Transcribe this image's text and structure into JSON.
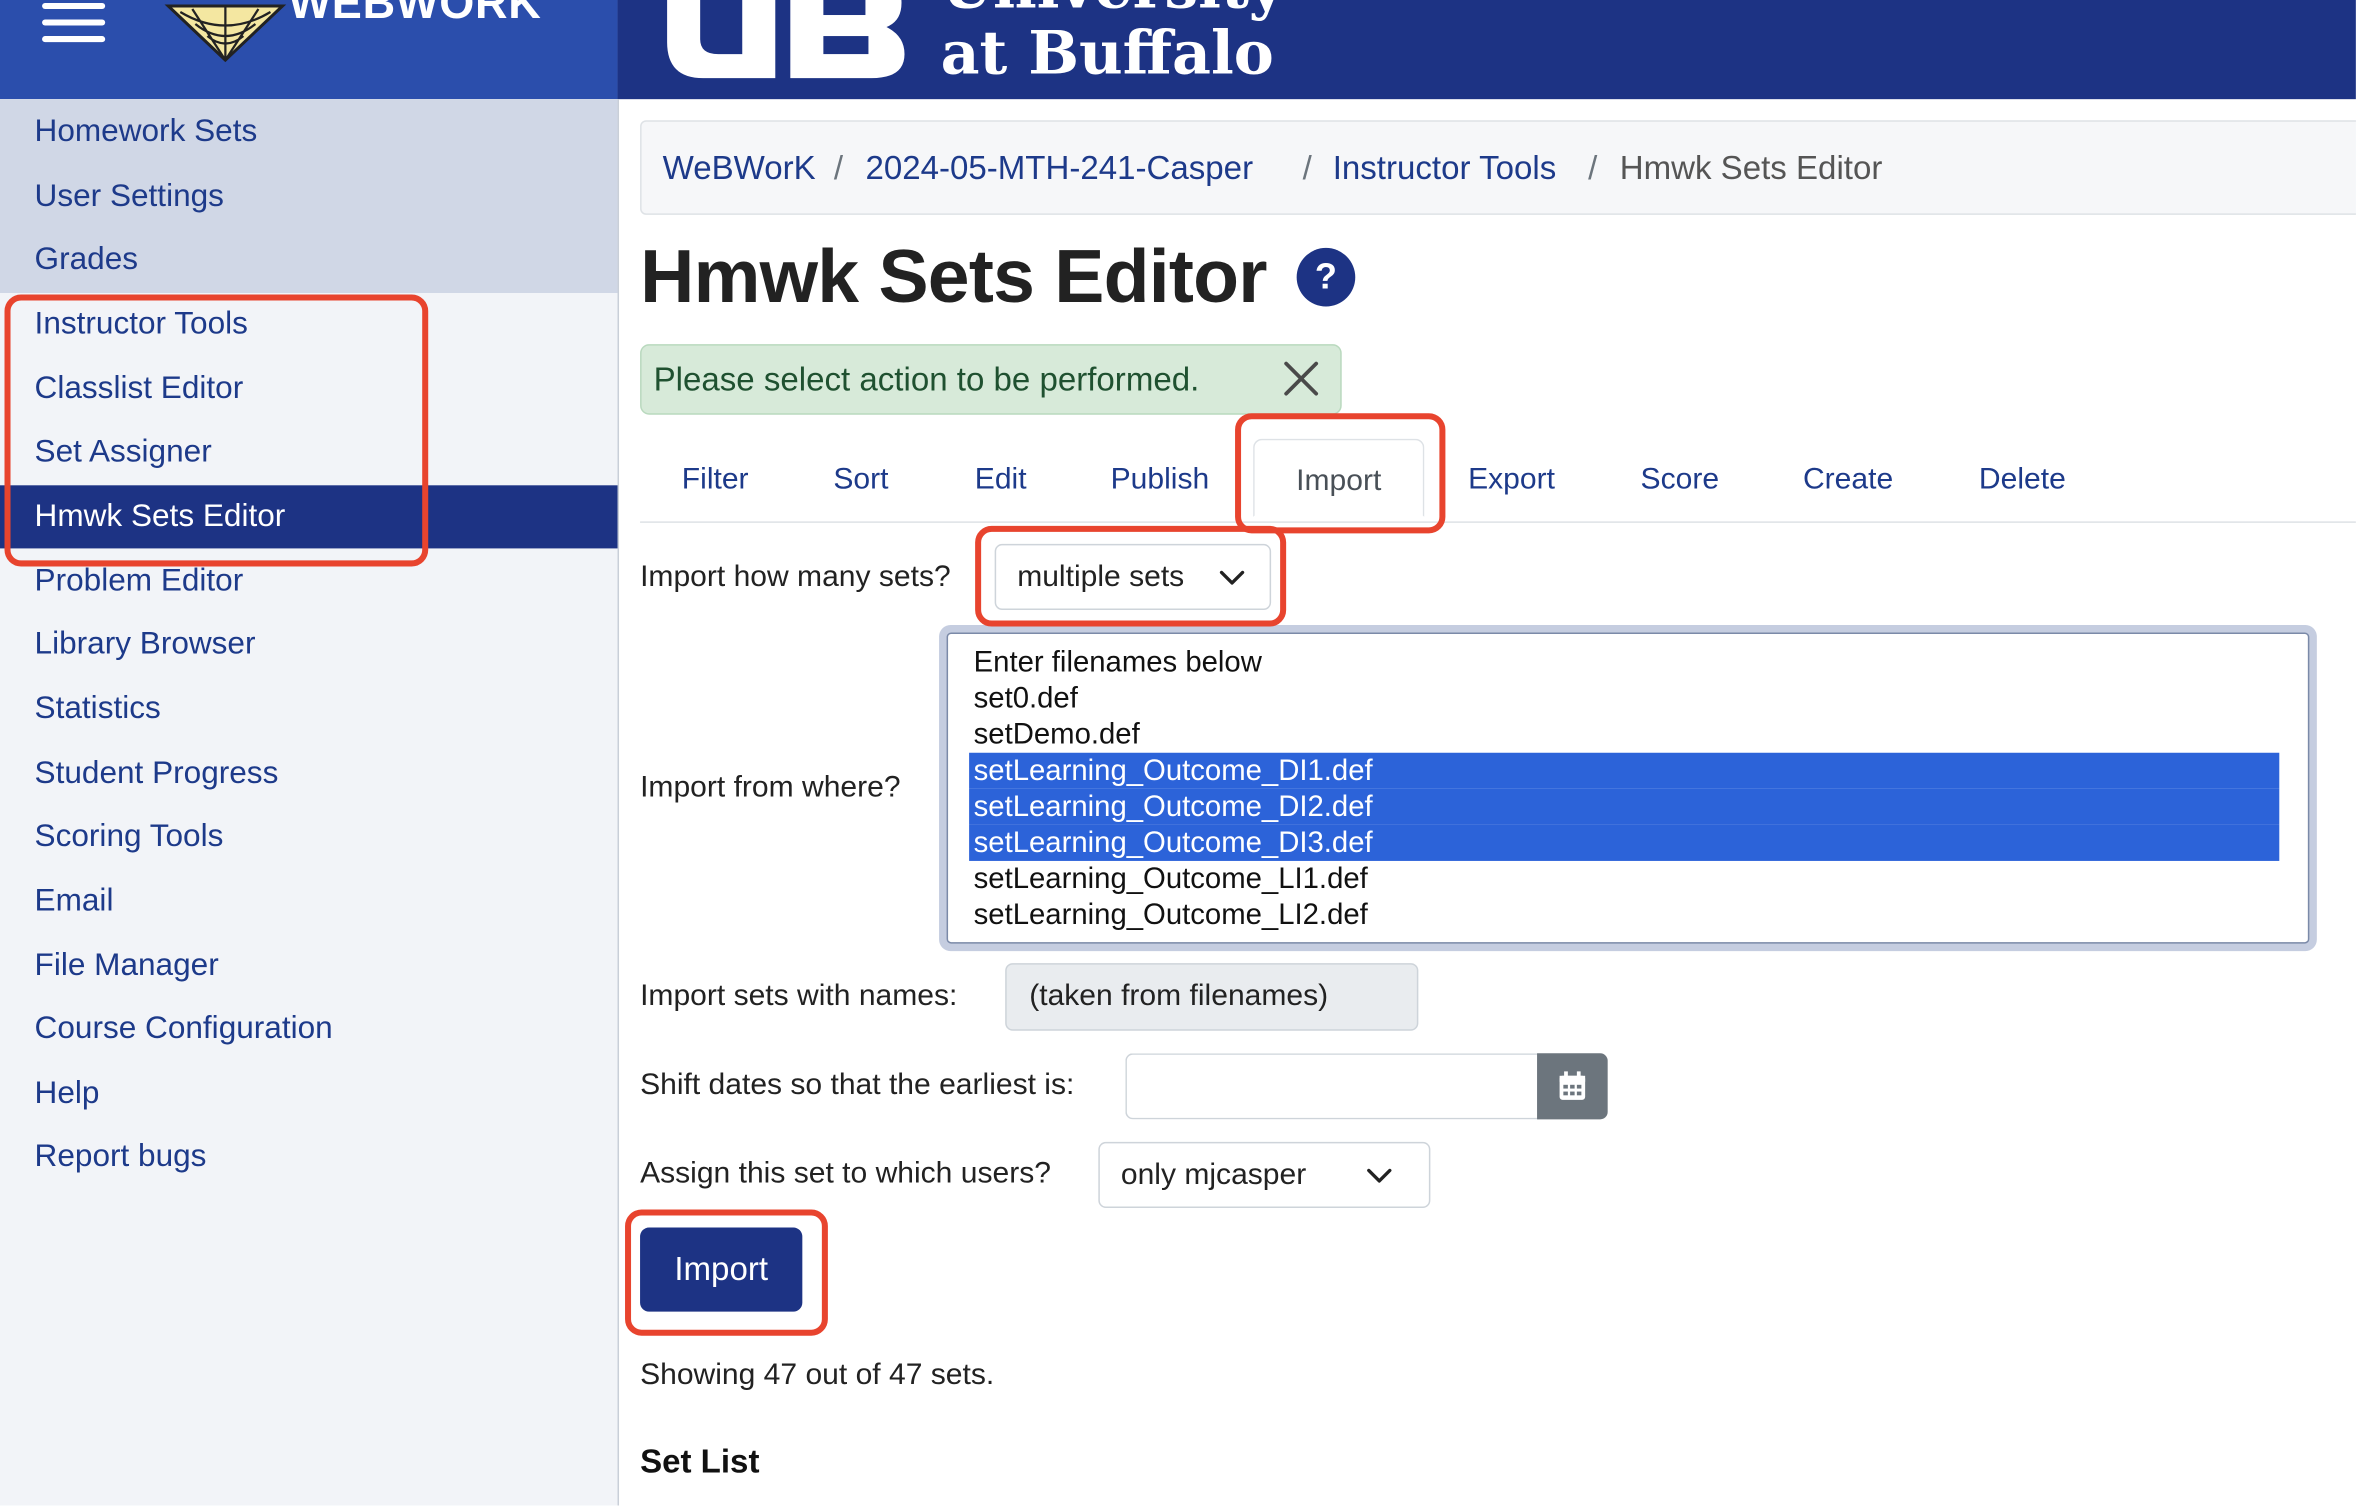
{
  "header": {
    "logo_text": "WEBWORK",
    "university_line1": "University",
    "university_line2": "at Buffalo"
  },
  "sidebar": {
    "items": [
      {
        "label": "Homework Sets"
      },
      {
        "label": "User Settings"
      },
      {
        "label": "Grades"
      },
      {
        "label": "Instructor Tools"
      },
      {
        "label": "Classlist Editor"
      },
      {
        "label": "Set Assigner"
      },
      {
        "label": "Hmwk Sets Editor",
        "active": true
      },
      {
        "label": "Problem Editor"
      },
      {
        "label": "Library Browser"
      },
      {
        "label": "Statistics"
      },
      {
        "label": "Student Progress"
      },
      {
        "label": "Scoring Tools"
      },
      {
        "label": "Email"
      },
      {
        "label": "File Manager"
      },
      {
        "label": "Course Configuration"
      },
      {
        "label": "Help"
      },
      {
        "label": "Report bugs"
      }
    ]
  },
  "breadcrumb": [
    "WeBWorK",
    "2024-05-MTH-241-Casper",
    "Instructor Tools",
    "Hmwk Sets Editor"
  ],
  "page_title": "Hmwk Sets Editor",
  "help_label": "?",
  "alert": {
    "message": "Please select action to be performed."
  },
  "tabs": [
    {
      "label": "Filter"
    },
    {
      "label": "Sort"
    },
    {
      "label": "Edit"
    },
    {
      "label": "Publish"
    },
    {
      "label": "Import",
      "active": true
    },
    {
      "label": "Export"
    },
    {
      "label": "Score"
    },
    {
      "label": "Create"
    },
    {
      "label": "Delete"
    }
  ],
  "form": {
    "how_many_label": "Import how many sets?",
    "how_many_value": "multiple sets",
    "from_where_label": "Import from where?",
    "files": [
      {
        "name": "Enter filenames below",
        "selected": false
      },
      {
        "name": "set0.def",
        "selected": false
      },
      {
        "name": "setDemo.def",
        "selected": false
      },
      {
        "name": "setLearning_Outcome_DI1.def",
        "selected": true
      },
      {
        "name": "setLearning_Outcome_DI2.def",
        "selected": true
      },
      {
        "name": "setLearning_Outcome_DI3.def",
        "selected": true
      },
      {
        "name": "setLearning_Outcome_LI1.def",
        "selected": false
      },
      {
        "name": "setLearning_Outcome_LI2.def",
        "selected": false
      }
    ],
    "names_label": "Import sets with names:",
    "names_value": "(taken from filenames)",
    "shift_label": "Shift dates so that the earliest is:",
    "shift_value": "",
    "assign_label": "Assign this set to which users?",
    "assign_value": "only mjcasper",
    "import_button": "Import"
  },
  "showing_text": "Showing 47 out of 47 sets.",
  "set_list_heading": "Set List",
  "colors": {
    "primary": "#1d3384",
    "sidebar_active": "#1d3384",
    "link": "#1d3a8a",
    "selection": "#2c63d9",
    "alert_bg": "#d7ead9",
    "highlight_outline": "#e8442e"
  }
}
